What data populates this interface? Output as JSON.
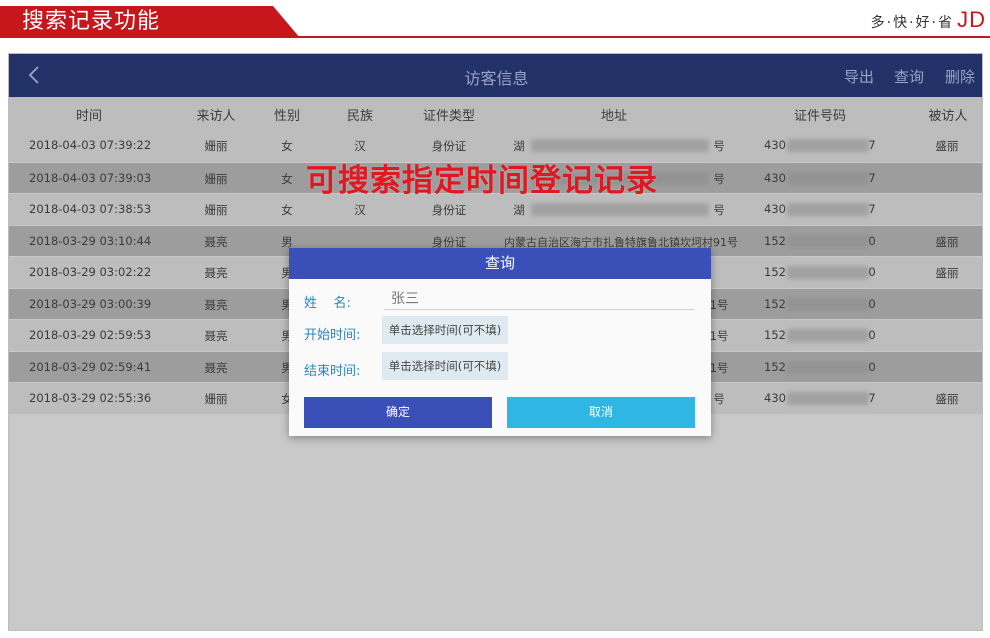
{
  "banner": {
    "title": "搜索记录功能",
    "slogan": "多·快·好·省",
    "brand": "JD"
  },
  "appbar": {
    "title": "访客信息",
    "actions": [
      "导出",
      "查询",
      "删除"
    ]
  },
  "table": {
    "headers": [
      "时间",
      "来访人",
      "性别",
      "民族",
      "证件类型",
      "地址",
      "证件号码",
      "被访人"
    ],
    "rows": [
      {
        "time": "2018-04-03 07:39:22",
        "visitor": "姗丽",
        "gender": "女",
        "ethnicity": "汉",
        "id_type": "身份证",
        "address_prefix": "湖",
        "address_suffix": "号",
        "id_prefix": "430",
        "id_suffix": "7",
        "host": "盛丽"
      },
      {
        "time": "2018-04-03 07:39:03",
        "visitor": "姗丽",
        "gender": "女",
        "ethnicity": "",
        "id_type": "",
        "address_prefix": "",
        "address_suffix": "号",
        "id_prefix": "430",
        "id_suffix": "7",
        "host": ""
      },
      {
        "time": "2018-04-03 07:38:53",
        "visitor": "姗丽",
        "gender": "女",
        "ethnicity": "汉",
        "id_type": "身份证",
        "address_prefix": "湖",
        "address_suffix": "号",
        "id_prefix": "430",
        "id_suffix": "7",
        "host": ""
      },
      {
        "time": "2018-03-29 03:10:44",
        "visitor": "聂亮",
        "gender": "男",
        "ethnicity": "",
        "id_type": "身份证",
        "address_prefix": "内蒙古自治区海宁市扎鲁特旗鲁北镇坎坷村91号",
        "address_suffix": "",
        "id_prefix": "152",
        "id_suffix": "0",
        "host": "盛丽"
      },
      {
        "time": "2018-03-29 03:02:22",
        "visitor": "聂亮",
        "gender": "男",
        "ethnicity": "",
        "id_type": "",
        "address_prefix": "",
        "address_suffix": "",
        "id_prefix": "152",
        "id_suffix": "0",
        "host": "盛丽"
      },
      {
        "time": "2018-03-29 03:00:39",
        "visitor": "聂亮",
        "gender": "男",
        "ethnicity": "",
        "id_type": "",
        "address_prefix": "",
        "address_suffix": "1号",
        "id_prefix": "152",
        "id_suffix": "0",
        "host": ""
      },
      {
        "time": "2018-03-29 02:59:53",
        "visitor": "聂亮",
        "gender": "男",
        "ethnicity": "",
        "id_type": "",
        "address_prefix": "",
        "address_suffix": "1号",
        "id_prefix": "152",
        "id_suffix": "0",
        "host": ""
      },
      {
        "time": "2018-03-29 02:59:41",
        "visitor": "聂亮",
        "gender": "男",
        "ethnicity": "",
        "id_type": "",
        "address_prefix": "",
        "address_suffix": "1号",
        "id_prefix": "152",
        "id_suffix": "0",
        "host": ""
      },
      {
        "time": "2018-03-29 02:55:36",
        "visitor": "姗丽",
        "gender": "女",
        "ethnicity": "",
        "id_type": "",
        "address_prefix": "",
        "address_suffix": "号",
        "id_prefix": "430",
        "id_suffix": "7",
        "host": "盛丽"
      }
    ]
  },
  "overlay_text": "可搜索指定时间登记记录",
  "dialog": {
    "title": "查询",
    "name_label": "姓    名:",
    "name_value": "张三",
    "start_label": "开始时间:",
    "start_button": "单击选择时间(可不填)",
    "end_label": "结束时间:",
    "end_button": "单击选择时间(可不填)",
    "ok_label": "确定",
    "cancel_label": "取消"
  },
  "colors": {
    "banner_red": "#c8161d",
    "appbar_navy": "#223167",
    "dialog_blue": "#3a4fb8",
    "cancel_cyan": "#2fb6e3",
    "watermark_red": "#e0181f"
  }
}
